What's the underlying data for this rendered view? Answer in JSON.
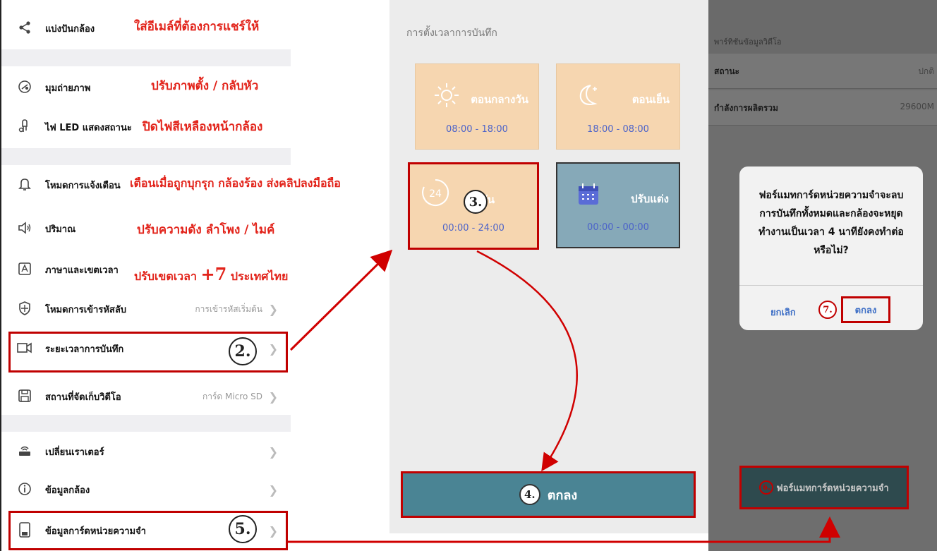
{
  "panel1": {
    "rows": [
      {
        "label": "แบ่งปันกล้อง",
        "value": "",
        "icon": "share-icon"
      },
      {
        "label": "มุมถ่ายภาพ",
        "value": "",
        "icon": "camera-angle-icon"
      },
      {
        "label": "ไฟ LED แสดงสถานะ",
        "value": "",
        "icon": "led-icon"
      },
      {
        "label": "โหมดการแจ้งเตือน",
        "value": "",
        "icon": "bell-icon"
      },
      {
        "label": "ปริมาณ",
        "value": "",
        "icon": "speaker-icon"
      },
      {
        "label": "ภาษาและเขตเวลา",
        "value": "",
        "icon": "language-icon"
      },
      {
        "label": "โหมดการเข้ารหัสลับ",
        "value": "การเข้ารหัสเริ่มต้น",
        "icon": "shield-icon"
      },
      {
        "label": "ระยะเวลาการบันทึก",
        "value": "",
        "icon": "video-icon"
      },
      {
        "label": "สถานที่จัดเก็บวิดีโอ",
        "value": "การ์ด Micro SD",
        "icon": "save-icon"
      },
      {
        "label": "เปลี่ยนเราเตอร์",
        "value": "",
        "icon": "router-icon"
      },
      {
        "label": "ข้อมูลกล้อง",
        "value": "",
        "icon": "info-icon"
      },
      {
        "label": "ข้อมูลการ์ดหน่วยความจำ",
        "value": "",
        "icon": "memory-card-icon"
      }
    ],
    "notes": {
      "share": "ใส่อีเมล์ที่ต้องการแชร์ให้",
      "angle": "ปรับภาพตั้ง / กลับหัว",
      "led": "ปิดไฟสีเหลืองหน้ากล้อง",
      "alert": "เตือนเมื่อถูกบุกรุก กล้องร้อง ส่งคลิปลงมือถือ",
      "volume": "ปรับความดัง ลำโพง / ไมค์",
      "tz_prefix": "ปรับเขตเวลา",
      "tz_plus": "+7",
      "tz_suffix": "ประเทศไทย"
    },
    "step2": "2.",
    "step5": "5."
  },
  "panel2": {
    "title": "การตั้งเวลาการบันทึก",
    "tiles": [
      {
        "name": "ตอนกลางวัน",
        "time": "08:00 - 18:00"
      },
      {
        "name": "ตอนเย็น",
        "time": "18:00 - 08:00"
      },
      {
        "name": "ทั้งวัน",
        "time": "00:00 - 24:00",
        "icon_text": "24"
      },
      {
        "name": "ปรับแต่ง",
        "time": "00:00 - 00:00"
      }
    ],
    "step3": "3.",
    "ok_label": "ตกลง",
    "step4": "4."
  },
  "panel3": {
    "section_title": "พาร์ทิชันข้อมูลวิดีโอ",
    "rows": [
      {
        "key": "สถานะ",
        "value": "ปกติ"
      },
      {
        "key": "กำลังการผลิตรวม",
        "value": "29600M"
      }
    ],
    "dialog": {
      "message": "ฟอร์แมทการ์ดหน่วยความจำจะลบการบันทึกทั้งหมดและกล้องจะหยุดทำงานเป็นเวลา 4 นาทียังคงทำต่อหรือไม่?",
      "cancel": "ยกเลิก",
      "ok": "ตกลง",
      "step7": "7."
    },
    "format_button": "ฟอร์แมทการ์ดหน่วยความจำ",
    "step6": "6."
  },
  "colors": {
    "annotation_red": "#e2231a",
    "box_red": "#c00000",
    "tile_peach": "#f6d6b0",
    "tile_teal": "#86a9b8",
    "ok_teal": "#4a8494"
  }
}
